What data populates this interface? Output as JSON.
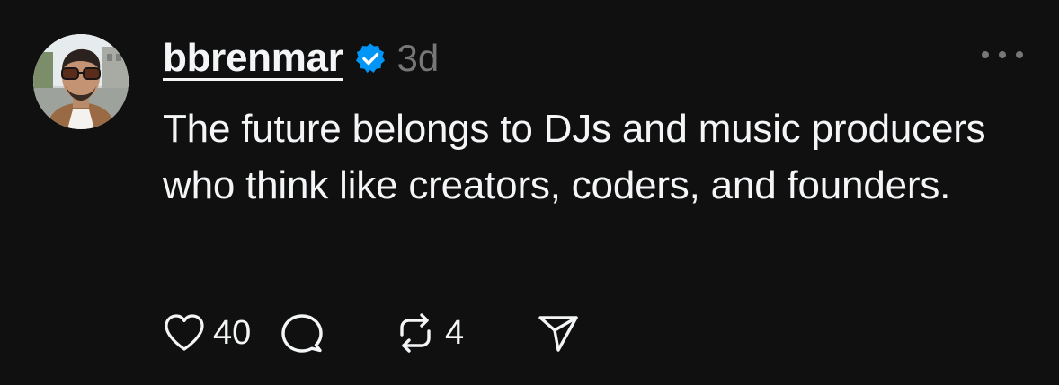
{
  "post": {
    "author": {
      "username": "bbrenmar",
      "verified": true,
      "avatar_icon": "profile-photo"
    },
    "timestamp": "3d",
    "text": "The future belongs to DJs and music producers who think like creators, coders, and founders.",
    "stats": {
      "likes": "40",
      "reposts": "4"
    },
    "icons": {
      "like": "heart-icon",
      "reply": "speech-bubble-icon",
      "repost": "repost-arrows-icon",
      "share": "send-plane-icon",
      "more": "more-dots-icon",
      "verified": "verified-badge-icon"
    },
    "colors": {
      "background": "#101010",
      "text": "#f3f5f7",
      "muted": "#777777",
      "verified": "#0095f6"
    }
  }
}
